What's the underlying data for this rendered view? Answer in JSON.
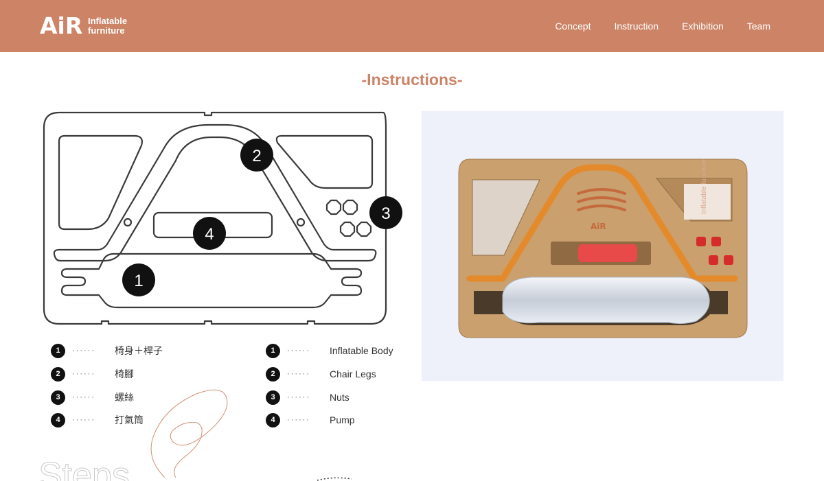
{
  "header": {
    "logo_mark": "AiR",
    "logo_text": "Inflatable furniture",
    "brand_color": "#cc8366",
    "nav": [
      "Concept",
      "Instruction",
      "Exhibition",
      "Team"
    ]
  },
  "main": {
    "title": "-Instructions-",
    "diagram_markers": [
      "1",
      "2",
      "3",
      "4"
    ],
    "photo": {
      "box_logo_mark": "AiR",
      "box_logo_text": "Inflatable furniture",
      "card_text": "Inflatable furniture"
    },
    "legend_zh": [
      {
        "num": "1",
        "dots": "······",
        "label": "椅身＋桿子"
      },
      {
        "num": "2",
        "dots": "······",
        "label": "椅腳"
      },
      {
        "num": "3",
        "dots": "······",
        "label": "螺絲"
      },
      {
        "num": "4",
        "dots": "······",
        "label": "打氣筒"
      }
    ],
    "legend_en": [
      {
        "num": "1",
        "dots": "······",
        "label": "Inflatable Body"
      },
      {
        "num": "2",
        "dots": "······",
        "label": "Chair Legs"
      },
      {
        "num": "3",
        "dots": "······",
        "label": "Nuts"
      },
      {
        "num": "4",
        "dots": "······",
        "label": "Pump"
      }
    ],
    "decor_text": "Steps"
  }
}
